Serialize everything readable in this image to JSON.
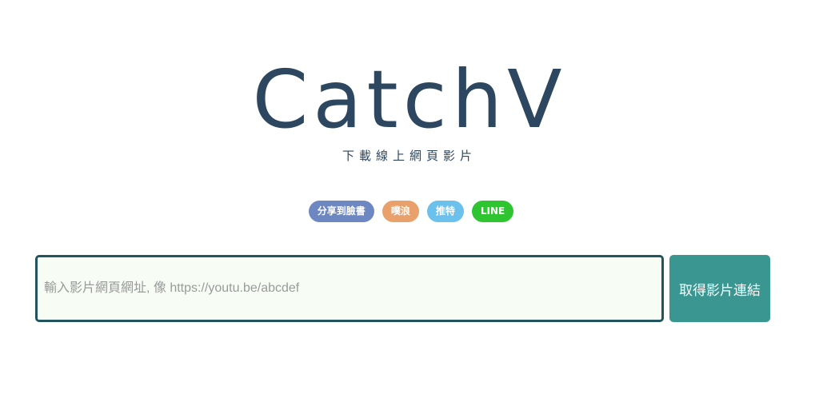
{
  "header": {
    "logo_text": "CatchV",
    "tagline": "下載線上網頁影片"
  },
  "share": {
    "facebook_label": "分享到臉書",
    "weibo_label": "噗浪",
    "twitter_label": "推特",
    "line_label": "LINE"
  },
  "form": {
    "url_placeholder": "輸入影片網頁網址, 像 https://youtu.be/abcdef",
    "url_value": "",
    "submit_label": "取得影片連結"
  },
  "colors": {
    "logo": "#2e4760",
    "facebook": "#6d87c2",
    "weibo": "#e9a06b",
    "twitter": "#6cc0ec",
    "line": "#2fc531",
    "input_border": "#21545c",
    "input_background": "#f7fdf5",
    "submit_button": "#3a9690"
  }
}
